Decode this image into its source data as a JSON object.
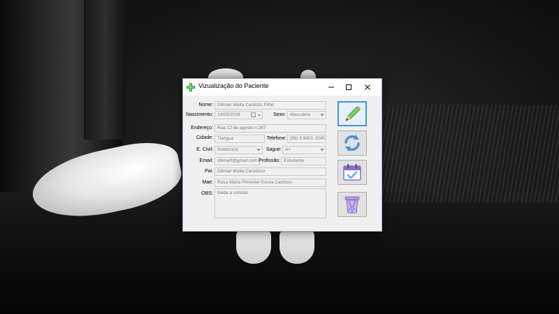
{
  "window": {
    "title": "Vizualização do Paciente"
  },
  "form": {
    "nome": {
      "label": "Nome:",
      "value": "Ditimar Moita Cardozo Filho"
    },
    "nascimento": {
      "label": "Nascimento:",
      "value": "19/05/2018"
    },
    "sexo": {
      "label": "Sexo:",
      "value": "Masculino"
    },
    "endereco": {
      "label": "Endereço:",
      "value": "Rua 12 de agosto n 287"
    },
    "cidade": {
      "label": "Cidade:",
      "value": "Tiangua"
    },
    "telefone": {
      "label": "Telefone:",
      "value": "(88) 9.9401-1545"
    },
    "estado_civil": {
      "label": "E. Civil:",
      "value": "Solteiro(a)"
    },
    "sangue": {
      "label": "Sague:",
      "value": "A+"
    },
    "email": {
      "label": "Email:",
      "value": "ditimarf@gmail.com"
    },
    "profissao": {
      "label": "Profissão:",
      "value": "Estudante"
    },
    "pai": {
      "label": "Pai:",
      "value": "Ditimar Moita Carodoso"
    },
    "mae": {
      "label": "Mae:",
      "value": "Rosa Maria Pimentel Souza Cardoso"
    },
    "obs": {
      "label": "OBS:",
      "value": "Nada a constar"
    }
  },
  "sidebar": {
    "buttons": [
      "edit",
      "refresh",
      "calendar",
      "delete"
    ]
  },
  "icons": {
    "app": "green-cross-icon",
    "minimize": "minimize-icon",
    "maximize": "maximize-icon",
    "close": "close-icon",
    "edit": "pencil-icon",
    "refresh": "refresh-icon",
    "calendar": "calendar-check-icon",
    "delete": "trash-icon"
  },
  "colors": {
    "accent": "#4a90d9",
    "app_icon": "#2e9d3a",
    "refresh": "#4a8fe0",
    "calendar": "#8a6bcf",
    "trash": "#9b7fd0"
  }
}
